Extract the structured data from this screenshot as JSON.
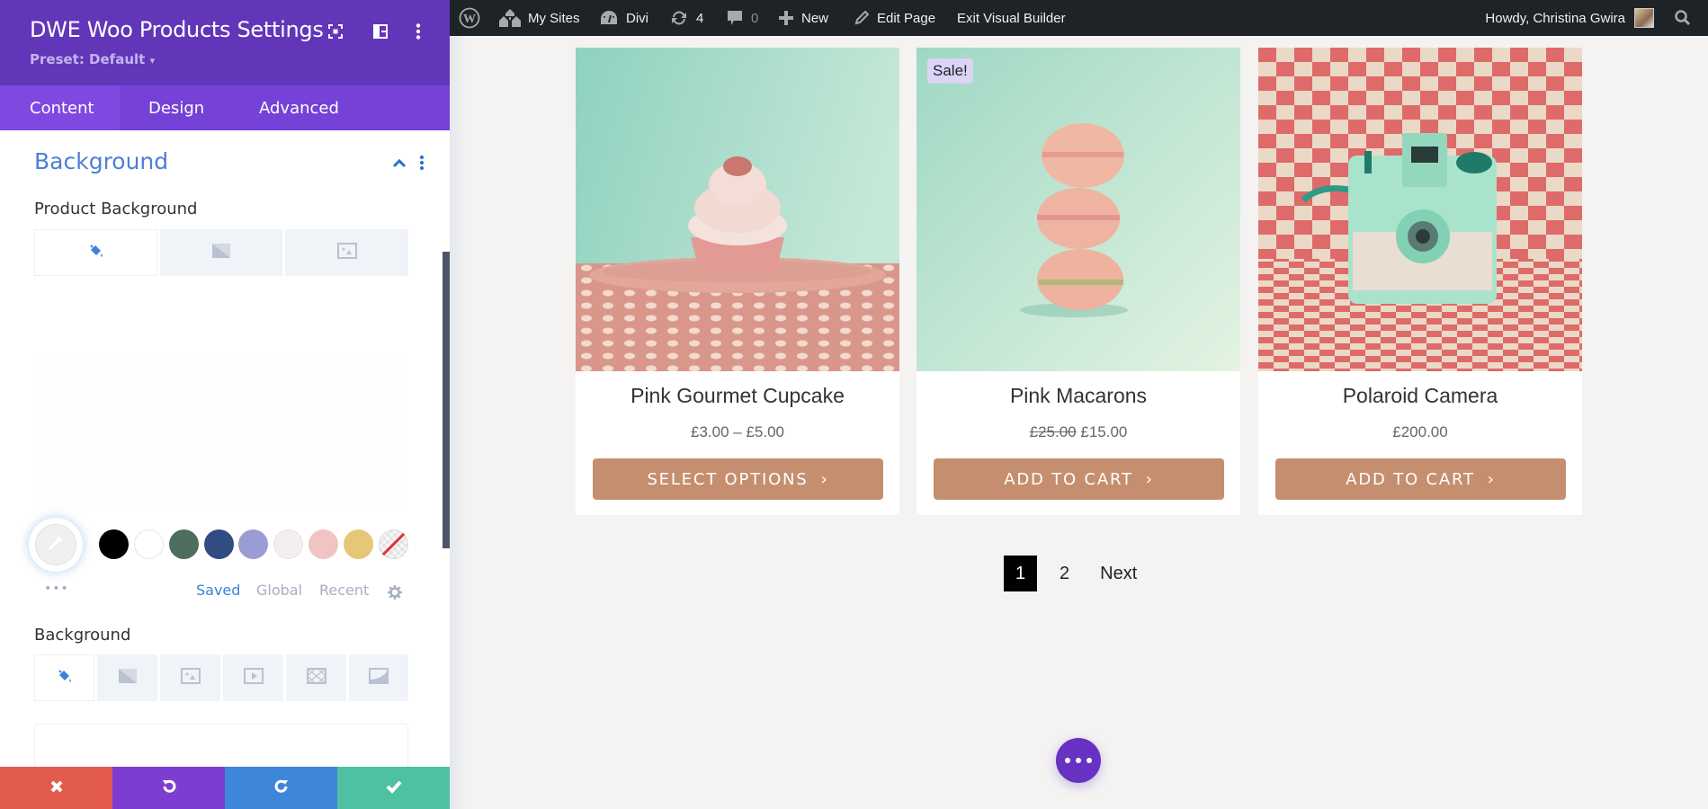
{
  "admin_bar": {
    "items": [
      {
        "icon": "wordpress-logo-icon",
        "label": ""
      },
      {
        "icon": "my-sites-icon",
        "label": "My Sites"
      },
      {
        "icon": "divi-dashboard-icon",
        "label": "Divi"
      },
      {
        "icon": "updates-icon",
        "label": "4"
      },
      {
        "icon": "comments-icon",
        "label": "0"
      },
      {
        "icon": "plus-icon",
        "label": "New"
      },
      {
        "icon": "pencil-icon",
        "label": "Edit Page"
      },
      {
        "icon": "",
        "label": "Exit Visual Builder"
      }
    ],
    "greeting": "Howdy, Christina Gwira",
    "search_icon": "search-icon"
  },
  "panel": {
    "title": "DWE Woo Products Settings",
    "preset": "Preset: Default",
    "preset_caret": "▾",
    "tabs": [
      {
        "label": "Content",
        "active": true
      },
      {
        "label": "Design",
        "active": false
      },
      {
        "label": "Advanced",
        "active": false
      }
    ],
    "section_title": "Background",
    "product_background_label": "Product Background",
    "product_background_tabs": [
      "color",
      "gradient",
      "image"
    ],
    "palette": {
      "swatches": [
        "#000000",
        "#ffffff",
        "#4f6d5f",
        "#314c82",
        "#9a9dd4",
        "#f5eeee",
        "#f1c3c3",
        "#e6c677",
        "none"
      ],
      "more": "•••",
      "tabs": [
        {
          "label": "Saved",
          "active": true
        },
        {
          "label": "Global",
          "active": false
        },
        {
          "label": "Recent",
          "active": false
        }
      ]
    },
    "background_label": "Background",
    "background_tabs": [
      "color",
      "gradient",
      "image",
      "video",
      "pattern",
      "mask"
    ],
    "actions": [
      {
        "name": "discard",
        "color": "#e35b4f"
      },
      {
        "name": "undo",
        "color": "#7d3dd1"
      },
      {
        "name": "redo",
        "color": "#3d86d9"
      },
      {
        "name": "save",
        "color": "#4fc1a3"
      }
    ]
  },
  "products": [
    {
      "title": "Pink Gourmet Cupcake",
      "price": "£3.00 – £5.00",
      "old_price": "",
      "sale": "",
      "button": "SELECT OPTIONS",
      "button_arrow": "›"
    },
    {
      "title": "Pink Macarons",
      "price": "£15.00",
      "old_price": "£25.00",
      "sale": "Sale!",
      "button": "ADD TO CART",
      "button_arrow": "›"
    },
    {
      "title": "Polaroid Camera",
      "price": "£200.00",
      "old_price": "",
      "sale": "",
      "button": "ADD TO CART",
      "button_arrow": "›"
    }
  ],
  "pagination": {
    "current": "1",
    "pages": [
      "2"
    ],
    "next": "Next"
  },
  "colors": {
    "builder_purple": "#6236b9",
    "tab_active": "#7f48e0",
    "accent_blue": "#4c7fd4",
    "button_tan": "#c58f6f",
    "sale_badge": "#dcd4f7"
  }
}
